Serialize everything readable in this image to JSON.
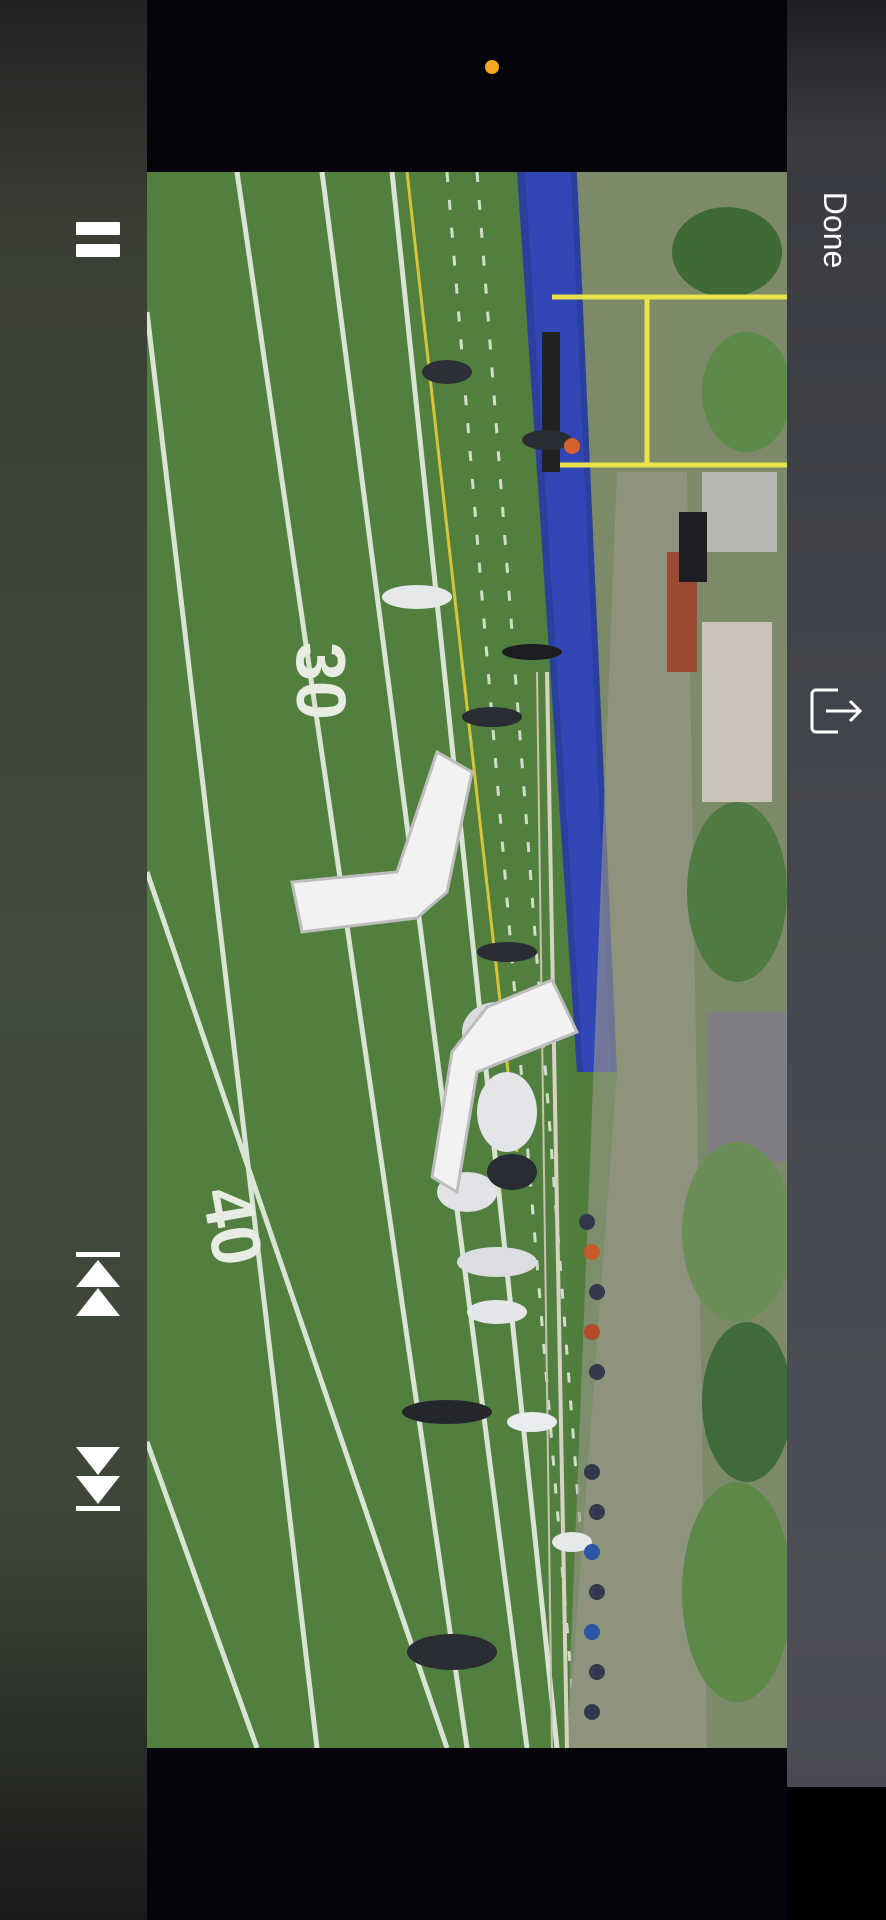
{
  "player": {
    "done_label": "Done"
  },
  "icons": {
    "pause": "pause-icon",
    "skip_back": "skip-back-icon",
    "skip_forward": "skip-forward-icon",
    "share": "share-icon",
    "indicator": "recording-indicator-dot"
  },
  "colors": {
    "indicator": "#f5a623",
    "field_green": "#4c7a3a",
    "track_blue": "#2b3f9e",
    "goalpost_yellow": "#e8e34a"
  },
  "video": {
    "yard_numbers": [
      "30",
      "40"
    ]
  }
}
